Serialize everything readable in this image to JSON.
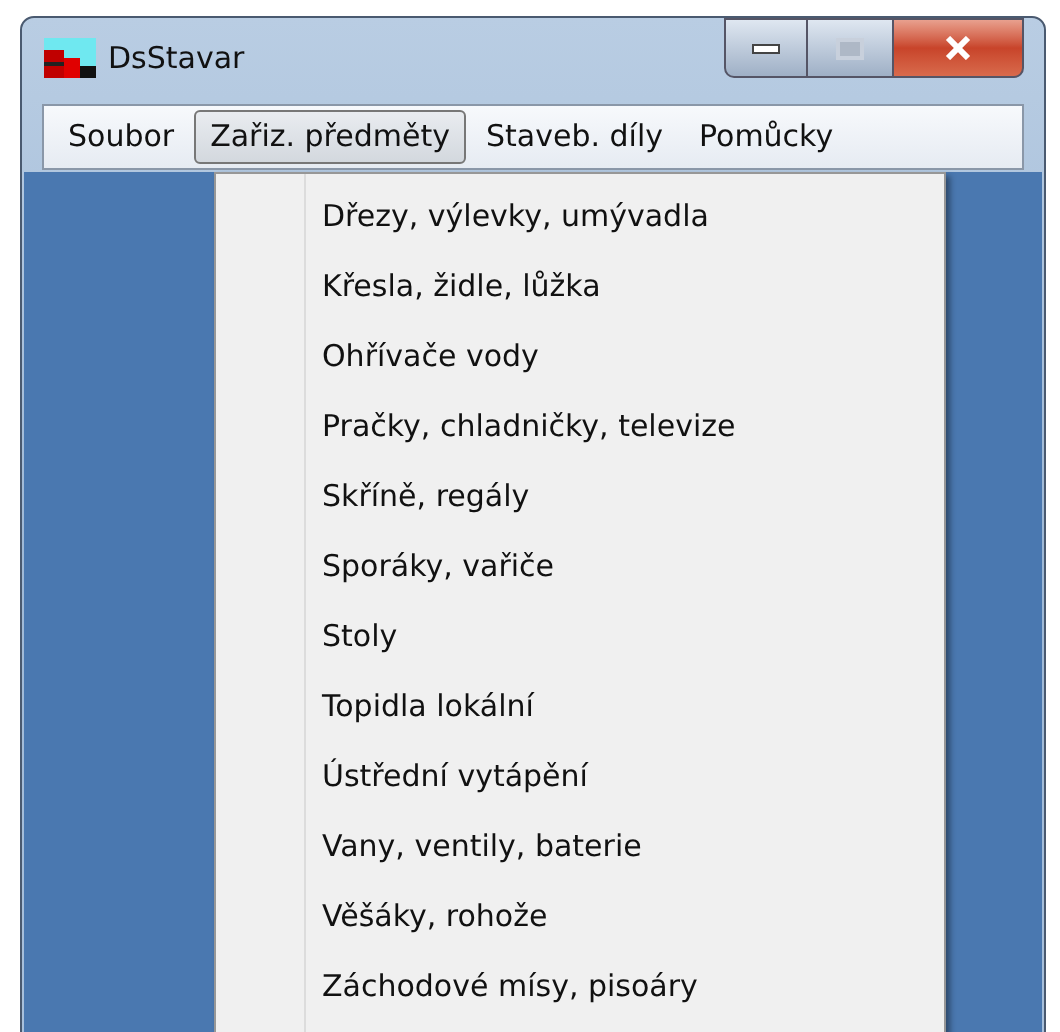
{
  "window": {
    "title": "DsStavar"
  },
  "menu_bar": [
    {
      "label": "Soubor",
      "selected": false
    },
    {
      "label": "Zařiz. předměty",
      "selected": true
    },
    {
      "label": "Staveb. díly",
      "selected": false
    },
    {
      "label": "Pomůcky",
      "selected": false
    }
  ],
  "dropdown": {
    "items": [
      "Dřezy, výlevky, umývadla",
      "Křesla, židle, lůžka",
      "Ohřívače vody",
      "Pračky, chladničky, televize",
      "Skříně, regály",
      "Sporáky, vařiče",
      "Stoly",
      "Topidla lokální",
      "Ústřední vytápění",
      "Vany, ventily, baterie",
      "Věšáky, rohože",
      "Záchodové mísy, pisoáry"
    ]
  }
}
